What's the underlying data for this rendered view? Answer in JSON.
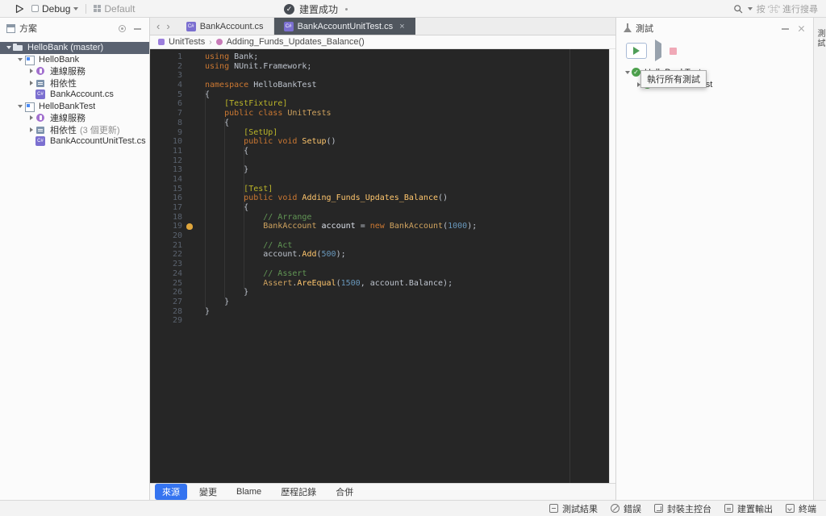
{
  "topbar": {
    "run_config": "Debug",
    "profile": "Default",
    "build_status": "建置成功",
    "search_hint": "按 '⌘' 進行搜尋"
  },
  "solution_panel": {
    "title": "方案",
    "tree": [
      {
        "label": "HelloBank (master)",
        "icon": "folder",
        "depth": 0,
        "arrow": "down",
        "selected": true
      },
      {
        "label": "HelloBank",
        "icon": "project",
        "depth": 1,
        "arrow": "down"
      },
      {
        "label": "連線服務",
        "icon": "plug",
        "depth": 2,
        "arrow": "right"
      },
      {
        "label": "相依性",
        "icon": "deps",
        "depth": 2,
        "arrow": "right"
      },
      {
        "label": "BankAccount.cs",
        "icon": "csfile",
        "depth": 2,
        "arrow": "none"
      },
      {
        "label": "HelloBankTest",
        "icon": "project",
        "depth": 1,
        "arrow": "down"
      },
      {
        "label": "連線服務",
        "icon": "plug",
        "depth": 2,
        "arrow": "right"
      },
      {
        "label": "相依性",
        "suffix": "(3 個更新)",
        "icon": "deps",
        "depth": 2,
        "arrow": "right"
      },
      {
        "label": "BankAccountUnitTest.cs",
        "icon": "csfile",
        "depth": 2,
        "arrow": "none"
      }
    ]
  },
  "editor": {
    "nav": {
      "back": "‹",
      "forward": "›"
    },
    "tabs": [
      {
        "label": "BankAccount.cs",
        "active": false
      },
      {
        "label": "BankAccountUnitTest.cs",
        "active": true,
        "close": "×"
      }
    ],
    "breadcrumbs": [
      {
        "label": "UnitTests",
        "icon": "class"
      },
      {
        "label": "Adding_Funds_Updates_Balance()",
        "icon": "method"
      }
    ],
    "bulb_line": 19,
    "code_lines": [
      [
        [
          "kw",
          "using "
        ],
        [
          "pl",
          "Bank;"
        ]
      ],
      [
        [
          "kw",
          "using "
        ],
        [
          "pl",
          "NUnit.Framework;"
        ]
      ],
      [],
      [
        [
          "kw",
          "namespace "
        ],
        [
          "pl",
          "HelloBankTest"
        ]
      ],
      [
        [
          "pl",
          "{"
        ]
      ],
      [
        [
          "pl",
          "    "
        ],
        [
          "attr",
          "[TestFixture]"
        ]
      ],
      [
        [
          "pl",
          "    "
        ],
        [
          "kw",
          "public class "
        ],
        [
          "type",
          "UnitTests"
        ]
      ],
      [
        [
          "pl",
          "    {"
        ]
      ],
      [
        [
          "pl",
          "        "
        ],
        [
          "attr",
          "[SetUp]"
        ]
      ],
      [
        [
          "pl",
          "        "
        ],
        [
          "kw",
          "public void "
        ],
        [
          "m",
          "Setup"
        ],
        [
          "pl",
          "()"
        ]
      ],
      [
        [
          "pl",
          "        {"
        ]
      ],
      [],
      [
        [
          "pl",
          "        }"
        ]
      ],
      [],
      [
        [
          "pl",
          "        "
        ],
        [
          "attr",
          "[Test]"
        ]
      ],
      [
        [
          "pl",
          "        "
        ],
        [
          "kw",
          "public void "
        ],
        [
          "m",
          "Adding_Funds_Updates_Balance"
        ],
        [
          "pl",
          "()"
        ]
      ],
      [
        [
          "pl",
          "        {"
        ]
      ],
      [
        [
          "pl",
          "            "
        ],
        [
          "cm",
          "// Arrange"
        ]
      ],
      [
        [
          "pl",
          "            "
        ],
        [
          "type",
          "BankAccount"
        ],
        [
          "pl",
          " "
        ],
        [
          "var",
          "account"
        ],
        [
          "pl",
          " = "
        ],
        [
          "kw",
          "new "
        ],
        [
          "type",
          "BankAccount"
        ],
        [
          "pl",
          "("
        ],
        [
          "num",
          "1000"
        ],
        [
          "pl",
          ");"
        ]
      ],
      [],
      [
        [
          "pl",
          "            "
        ],
        [
          "cm",
          "// Act"
        ]
      ],
      [
        [
          "pl",
          "            account."
        ],
        [
          "m",
          "Add"
        ],
        [
          "pl",
          "("
        ],
        [
          "num",
          "500"
        ],
        [
          "pl",
          ");"
        ]
      ],
      [],
      [
        [
          "pl",
          "            "
        ],
        [
          "cm",
          "// Assert"
        ]
      ],
      [
        [
          "pl",
          "            "
        ],
        [
          "type",
          "Assert"
        ],
        [
          "pl",
          "."
        ],
        [
          "m",
          "AreEqual"
        ],
        [
          "pl",
          "("
        ],
        [
          "num",
          "1500"
        ],
        [
          "pl",
          ", account.Balance);"
        ]
      ],
      [
        [
          "pl",
          "        }"
        ]
      ],
      [
        [
          "pl",
          "    }"
        ]
      ],
      [
        [
          "pl",
          "}"
        ]
      ],
      []
    ],
    "bottom_tabs": [
      {
        "label": "來源",
        "active": true
      },
      {
        "label": "變更",
        "active": false
      },
      {
        "label": "Blame",
        "active": false
      },
      {
        "label": "歷程記錄",
        "active": false
      },
      {
        "label": "合併",
        "active": false
      }
    ]
  },
  "tests_panel": {
    "title": "測試",
    "tooltip": "執行所有測試",
    "tree": [
      {
        "label": "HelloBankTest",
        "depth": 0,
        "arrow": "down",
        "status": "passed"
      },
      {
        "label": "HelloBankTest",
        "depth": 1,
        "arrow": "right",
        "status": "passed"
      }
    ]
  },
  "right_dock": {
    "tab": "測試"
  },
  "statusbar": {
    "items": [
      {
        "label": "測試結果",
        "icon": "test-results"
      },
      {
        "label": "錯誤",
        "icon": "errors"
      },
      {
        "label": "封裝主控台",
        "icon": "package-console"
      },
      {
        "label": "建置輸出",
        "icon": "build-output"
      },
      {
        "label": "終端",
        "icon": "terminal"
      }
    ]
  }
}
